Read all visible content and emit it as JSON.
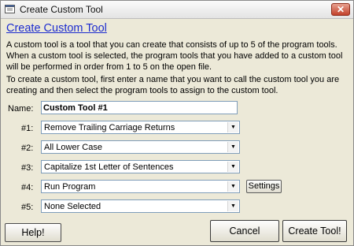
{
  "window": {
    "title": "Create Custom Tool",
    "close_glyph": "✕",
    "app_icon": "notepad-icon"
  },
  "heading": "Create Custom Tool",
  "description": {
    "paragraph1": "A custom tool is a tool that you can create that consists of up to 5 of the program tools.  When a custom tool is selected, the program tools that you have added to a custom tool will be performed in order from 1 to 5 on the open file.",
    "paragraph2": "To create a custom tool, first enter a name that you want to call the custom tool you are creating and then select the program tools to assign to the custom tool."
  },
  "name_field": {
    "label": "Name:",
    "value": "Custom Tool #1"
  },
  "tools": [
    {
      "label": "#1:",
      "value": "Remove Trailing Carriage Returns"
    },
    {
      "label": "#2:",
      "value": "All Lower Case"
    },
    {
      "label": "#3:",
      "value": "Capitalize 1st Letter of Sentences"
    },
    {
      "label": "#4:",
      "value": "Run Program"
    },
    {
      "label": "#5:",
      "value": "None Selected"
    }
  ],
  "buttons": {
    "settings": "Settings",
    "help": "Help!",
    "cancel": "Cancel",
    "create": "Create Tool!"
  }
}
